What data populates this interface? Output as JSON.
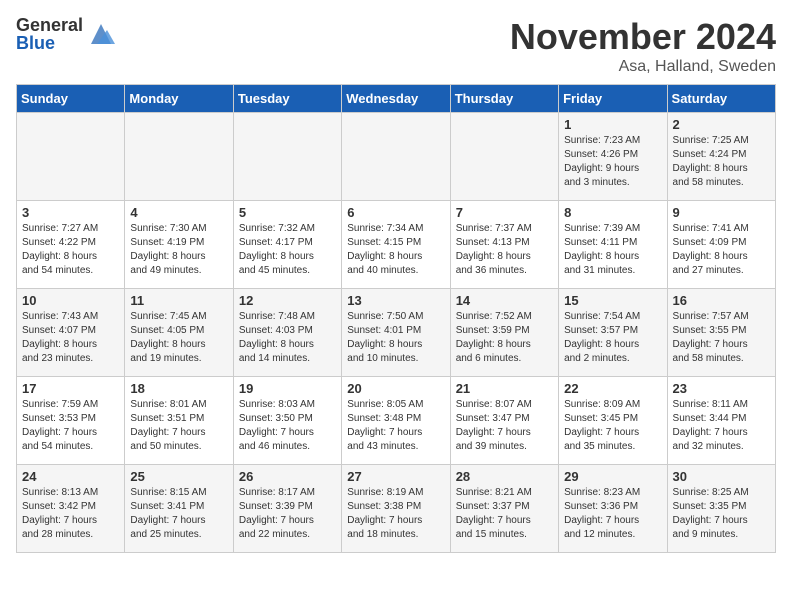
{
  "logo": {
    "general": "General",
    "blue": "Blue"
  },
  "title": "November 2024",
  "location": "Asa, Halland, Sweden",
  "days_of_week": [
    "Sunday",
    "Monday",
    "Tuesday",
    "Wednesday",
    "Thursday",
    "Friday",
    "Saturday"
  ],
  "weeks": [
    [
      {
        "day": "",
        "info": ""
      },
      {
        "day": "",
        "info": ""
      },
      {
        "day": "",
        "info": ""
      },
      {
        "day": "",
        "info": ""
      },
      {
        "day": "",
        "info": ""
      },
      {
        "day": "1",
        "info": "Sunrise: 7:23 AM\nSunset: 4:26 PM\nDaylight: 9 hours\nand 3 minutes."
      },
      {
        "day": "2",
        "info": "Sunrise: 7:25 AM\nSunset: 4:24 PM\nDaylight: 8 hours\nand 58 minutes."
      }
    ],
    [
      {
        "day": "3",
        "info": "Sunrise: 7:27 AM\nSunset: 4:22 PM\nDaylight: 8 hours\nand 54 minutes."
      },
      {
        "day": "4",
        "info": "Sunrise: 7:30 AM\nSunset: 4:19 PM\nDaylight: 8 hours\nand 49 minutes."
      },
      {
        "day": "5",
        "info": "Sunrise: 7:32 AM\nSunset: 4:17 PM\nDaylight: 8 hours\nand 45 minutes."
      },
      {
        "day": "6",
        "info": "Sunrise: 7:34 AM\nSunset: 4:15 PM\nDaylight: 8 hours\nand 40 minutes."
      },
      {
        "day": "7",
        "info": "Sunrise: 7:37 AM\nSunset: 4:13 PM\nDaylight: 8 hours\nand 36 minutes."
      },
      {
        "day": "8",
        "info": "Sunrise: 7:39 AM\nSunset: 4:11 PM\nDaylight: 8 hours\nand 31 minutes."
      },
      {
        "day": "9",
        "info": "Sunrise: 7:41 AM\nSunset: 4:09 PM\nDaylight: 8 hours\nand 27 minutes."
      }
    ],
    [
      {
        "day": "10",
        "info": "Sunrise: 7:43 AM\nSunset: 4:07 PM\nDaylight: 8 hours\nand 23 minutes."
      },
      {
        "day": "11",
        "info": "Sunrise: 7:45 AM\nSunset: 4:05 PM\nDaylight: 8 hours\nand 19 minutes."
      },
      {
        "day": "12",
        "info": "Sunrise: 7:48 AM\nSunset: 4:03 PM\nDaylight: 8 hours\nand 14 minutes."
      },
      {
        "day": "13",
        "info": "Sunrise: 7:50 AM\nSunset: 4:01 PM\nDaylight: 8 hours\nand 10 minutes."
      },
      {
        "day": "14",
        "info": "Sunrise: 7:52 AM\nSunset: 3:59 PM\nDaylight: 8 hours\nand 6 minutes."
      },
      {
        "day": "15",
        "info": "Sunrise: 7:54 AM\nSunset: 3:57 PM\nDaylight: 8 hours\nand 2 minutes."
      },
      {
        "day": "16",
        "info": "Sunrise: 7:57 AM\nSunset: 3:55 PM\nDaylight: 7 hours\nand 58 minutes."
      }
    ],
    [
      {
        "day": "17",
        "info": "Sunrise: 7:59 AM\nSunset: 3:53 PM\nDaylight: 7 hours\nand 54 minutes."
      },
      {
        "day": "18",
        "info": "Sunrise: 8:01 AM\nSunset: 3:51 PM\nDaylight: 7 hours\nand 50 minutes."
      },
      {
        "day": "19",
        "info": "Sunrise: 8:03 AM\nSunset: 3:50 PM\nDaylight: 7 hours\nand 46 minutes."
      },
      {
        "day": "20",
        "info": "Sunrise: 8:05 AM\nSunset: 3:48 PM\nDaylight: 7 hours\nand 43 minutes."
      },
      {
        "day": "21",
        "info": "Sunrise: 8:07 AM\nSunset: 3:47 PM\nDaylight: 7 hours\nand 39 minutes."
      },
      {
        "day": "22",
        "info": "Sunrise: 8:09 AM\nSunset: 3:45 PM\nDaylight: 7 hours\nand 35 minutes."
      },
      {
        "day": "23",
        "info": "Sunrise: 8:11 AM\nSunset: 3:44 PM\nDaylight: 7 hours\nand 32 minutes."
      }
    ],
    [
      {
        "day": "24",
        "info": "Sunrise: 8:13 AM\nSunset: 3:42 PM\nDaylight: 7 hours\nand 28 minutes."
      },
      {
        "day": "25",
        "info": "Sunrise: 8:15 AM\nSunset: 3:41 PM\nDaylight: 7 hours\nand 25 minutes."
      },
      {
        "day": "26",
        "info": "Sunrise: 8:17 AM\nSunset: 3:39 PM\nDaylight: 7 hours\nand 22 minutes."
      },
      {
        "day": "27",
        "info": "Sunrise: 8:19 AM\nSunset: 3:38 PM\nDaylight: 7 hours\nand 18 minutes."
      },
      {
        "day": "28",
        "info": "Sunrise: 8:21 AM\nSunset: 3:37 PM\nDaylight: 7 hours\nand 15 minutes."
      },
      {
        "day": "29",
        "info": "Sunrise: 8:23 AM\nSunset: 3:36 PM\nDaylight: 7 hours\nand 12 minutes."
      },
      {
        "day": "30",
        "info": "Sunrise: 8:25 AM\nSunset: 3:35 PM\nDaylight: 7 hours\nand 9 minutes."
      }
    ]
  ]
}
